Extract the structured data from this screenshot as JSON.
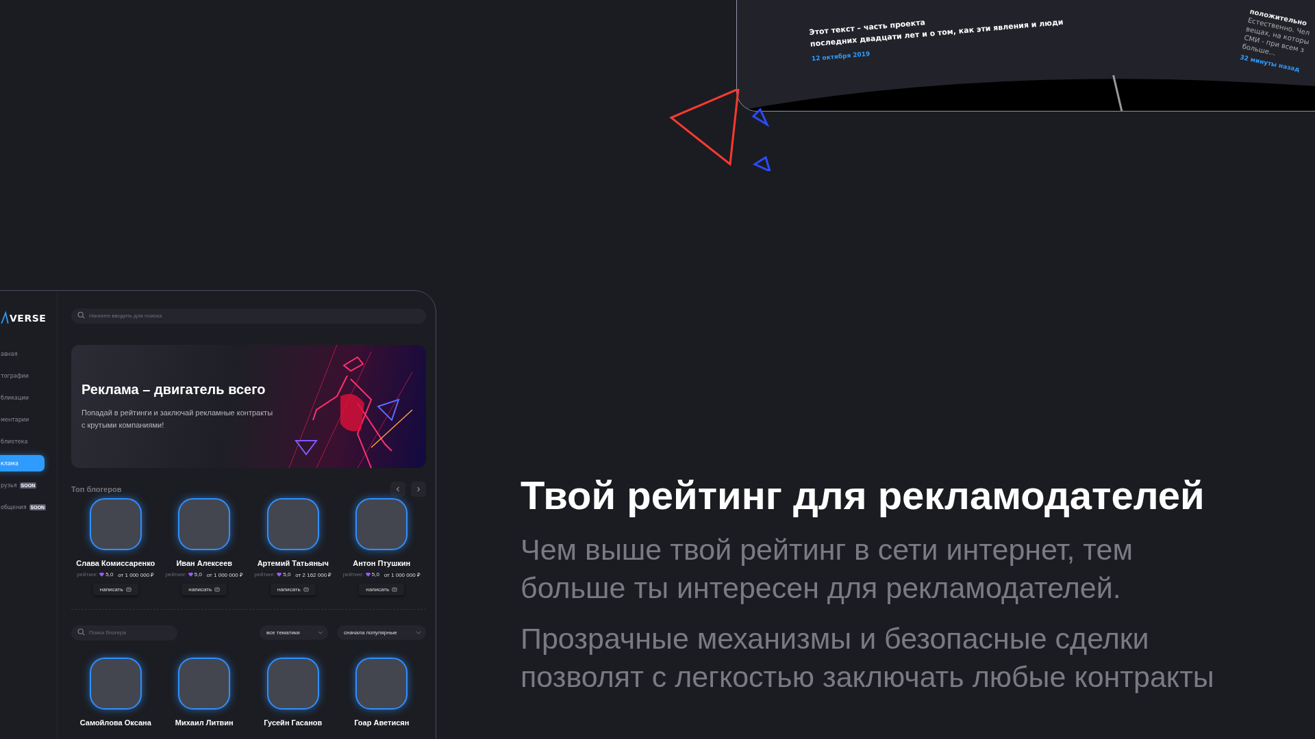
{
  "device_screen": {
    "post_lines": [
      "Этот текст – часть проекта",
      "последних двадцати лет и о том, как эти явления и люди"
    ],
    "post_date": "12 октября 2019",
    "comment_mood": "положительно",
    "comment_lines": [
      "Естественно. Чел",
      "вещах, на которы",
      "СМИ - при всем з",
      "больше..."
    ],
    "comment_time": "32 минуты назад"
  },
  "sidebar": {
    "logo": "VERSE",
    "items": [
      {
        "label": "авная",
        "selected": false
      },
      {
        "label": "тографии",
        "selected": false
      },
      {
        "label": "бликации",
        "selected": false
      },
      {
        "label": "ментарии",
        "selected": false
      },
      {
        "label": "блиотека",
        "selected": false
      },
      {
        "label": "клама",
        "selected": true
      },
      {
        "label": "рузья",
        "selected": false,
        "badge": "SOON"
      },
      {
        "label": "общения",
        "selected": false,
        "badge": "SOON"
      }
    ]
  },
  "search": {
    "placeholder": "Начните вводить для поиска"
  },
  "banner": {
    "title": "Реклама – двигатель всего",
    "text": "Попадай в рейтинги и заключай рекламные контракты с крутыми компаниями!"
  },
  "top_bloggers": {
    "title": "Топ блогеров",
    "cards": [
      {
        "name": "Слава Комиссаренко",
        "rating_label": "рейтинг:",
        "rating": "5,0",
        "price": "от 1 000 000 ₽",
        "button": "написать"
      },
      {
        "name": "Иван Алексеев",
        "rating_label": "рейтинг:",
        "rating": "5,0",
        "price": "от 1 000 000 ₽",
        "button": "написать"
      },
      {
        "name": "Артемий Татьяныч",
        "rating_label": "рейтинг:",
        "rating": "5,0",
        "price": "от 2 162 000 ₽",
        "button": "написать"
      },
      {
        "name": "Антон Птушкин",
        "rating_label": "рейтинг:",
        "rating": "5,0",
        "price": "от 1 000 000 ₽",
        "button": "написать"
      }
    ]
  },
  "filters": {
    "search_placeholder": "Поиск блогера",
    "topic": "все тематики",
    "sort": "сначала популярные"
  },
  "bloggers": [
    {
      "name": "Самойлова Оксана"
    },
    {
      "name": "Михаил Литвин"
    },
    {
      "name": "Гусейн Гасанов"
    },
    {
      "name": "Гоар Аветисян"
    }
  ],
  "headline": "Твой рейтинг для рекламодателей",
  "paragraphs": [
    "Чем выше твой рейтинг в сети интернет, тем больше ты интересен для рекламодателей.",
    "Прозрачные механизмы и безопасные сделки позволят с легкостью заключать любые контракты"
  ]
}
